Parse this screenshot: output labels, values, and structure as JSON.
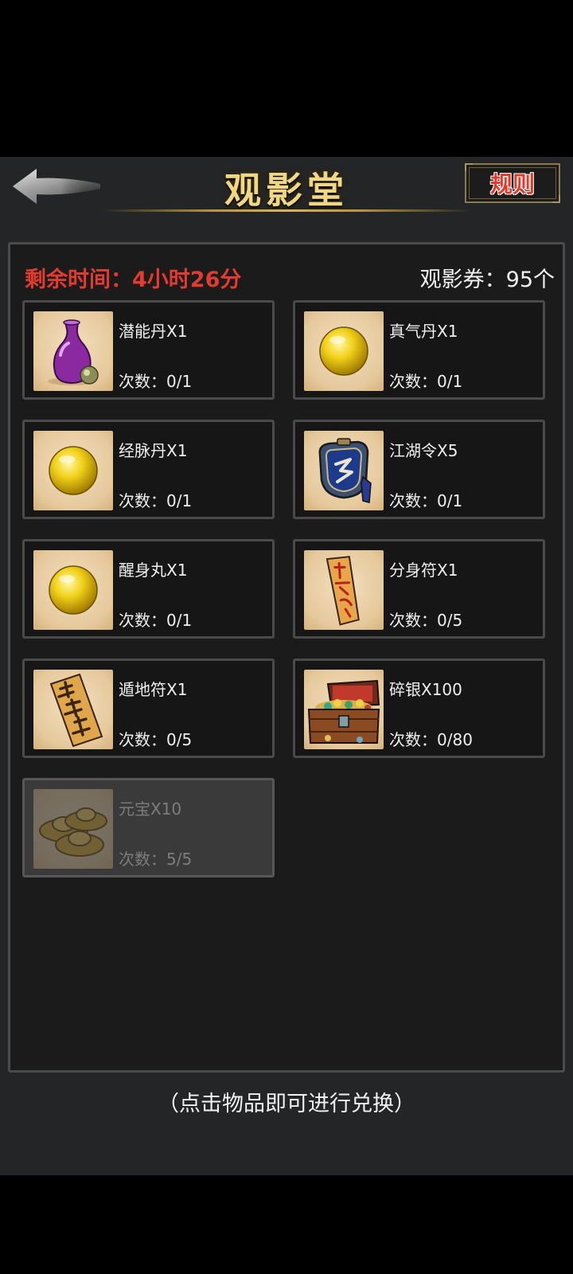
{
  "header": {
    "title": "观影堂",
    "back_icon": "back-arrow-icon",
    "rules_label": "规则"
  },
  "status": {
    "remaining_label": "剩余时间：",
    "remaining_value": "4小时26分",
    "tickets_label": "观影券：",
    "tickets_value": "95个"
  },
  "items": [
    {
      "name": "潜能丹X1",
      "count_label": "次数：",
      "count": "0/1",
      "icon": "purple-vase-icon"
    },
    {
      "name": "真气丹X1",
      "count_label": "次数：",
      "count": "0/1",
      "icon": "golden-pill-icon"
    },
    {
      "name": "经脉丹X1",
      "count_label": "次数：",
      "count": "0/1",
      "icon": "golden-pill-icon"
    },
    {
      "name": "江湖令X5",
      "count_label": "次数：",
      "count": "0/1",
      "icon": "blue-token-icon"
    },
    {
      "name": "醒身丸X1",
      "count_label": "次数：",
      "count": "0/1",
      "icon": "golden-pill-icon"
    },
    {
      "name": "分身符X1",
      "count_label": "次数：",
      "count": "0/5",
      "icon": "talisman-icon"
    },
    {
      "name": "遁地符X1",
      "count_label": "次数：",
      "count": "0/5",
      "icon": "scroll-talisman-icon"
    },
    {
      "name": "碎银X100",
      "count_label": "次数：",
      "count": "0/80",
      "icon": "treasure-chest-icon"
    },
    {
      "name": "元宝X10",
      "count_label": "次数：",
      "count": "5/5",
      "icon": "gold-ingot-icon",
      "disabled": true
    }
  ],
  "footer": {
    "hint": "（点击物品即可进行兑换）"
  },
  "colors": {
    "title_gold": "#f0d784",
    "remaining_red": "#e33b30",
    "panel_bg": "#1b1b1b",
    "app_bg": "#242526"
  }
}
